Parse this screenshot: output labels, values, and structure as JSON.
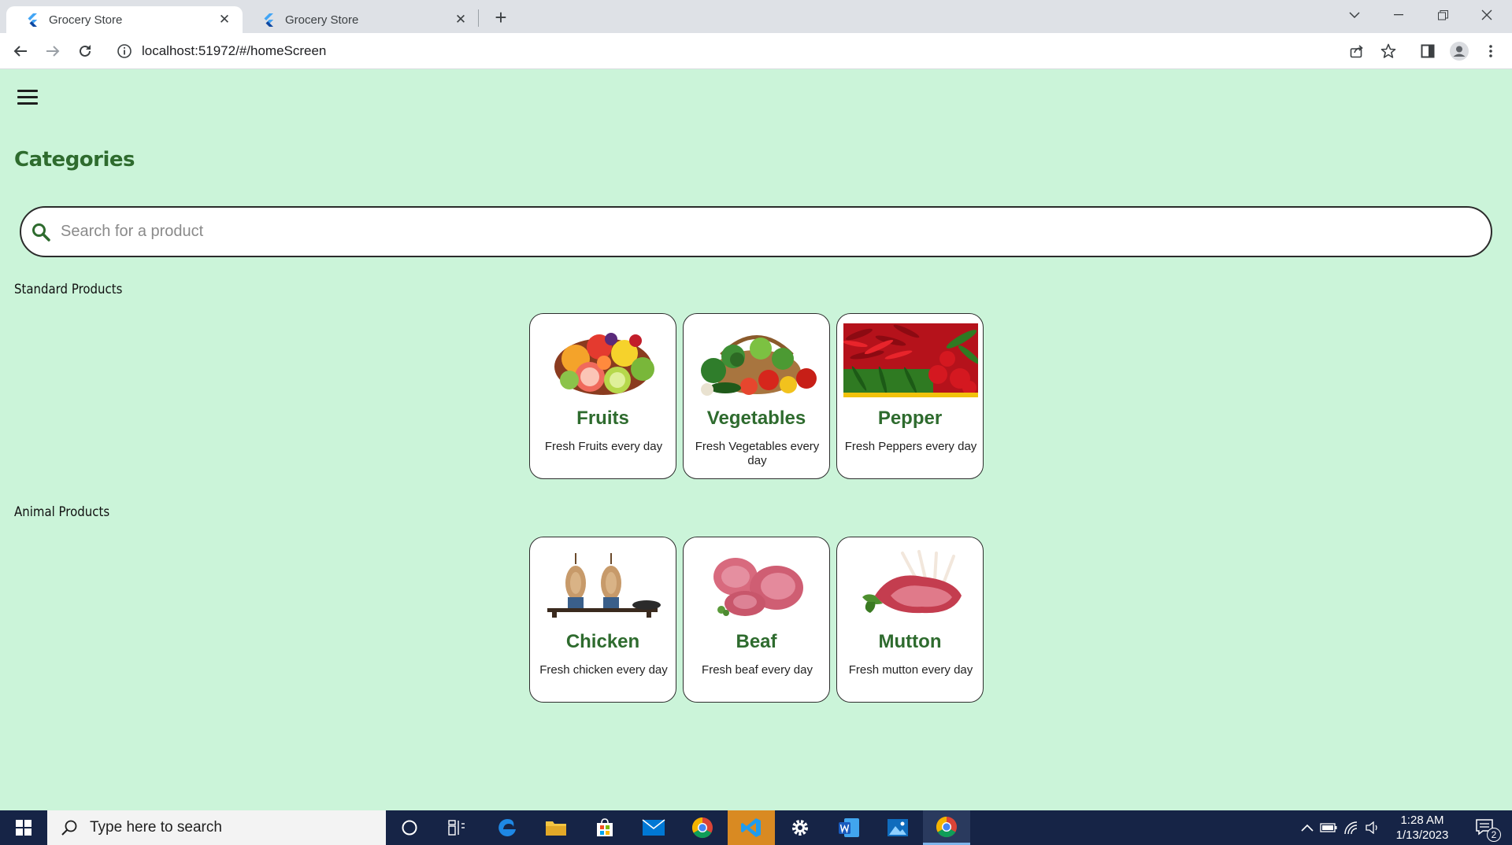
{
  "browser": {
    "tabs": [
      {
        "title": "Grocery Store",
        "active": true
      },
      {
        "title": "Grocery Store",
        "active": false
      }
    ],
    "url": "localhost:51972/#/homeScreen"
  },
  "app": {
    "page_title": "Categories",
    "search": {
      "placeholder": "Search for a product",
      "value": ""
    },
    "sections": [
      {
        "title": "Standard Products",
        "items": [
          {
            "name": "Fruits",
            "subtitle": "Fresh Fruits every day",
            "image": "fruits-image"
          },
          {
            "name": "Vegetables",
            "subtitle": "Fresh Vegetables every day",
            "image": "vegetables-image"
          },
          {
            "name": "Pepper",
            "subtitle": "Fresh Peppers every day",
            "image": "pepper-image"
          }
        ]
      },
      {
        "title": "Animal Products",
        "items": [
          {
            "name": "Chicken",
            "subtitle": "Fresh chicken every day",
            "image": "chicken-image"
          },
          {
            "name": "Beaf",
            "subtitle": "Fresh beaf every day",
            "image": "beef-image"
          },
          {
            "name": "Mutton",
            "subtitle": "Fresh mutton every day",
            "image": "mutton-image"
          }
        ]
      }
    ]
  },
  "taskbar": {
    "search_placeholder": "Type here to search",
    "time": "1:28 AM",
    "date": "1/13/2023",
    "notifications": "2"
  },
  "colors": {
    "page_background": "#cbf4d9",
    "accent_green": "#2e6b2e",
    "taskbar": "#162446"
  }
}
